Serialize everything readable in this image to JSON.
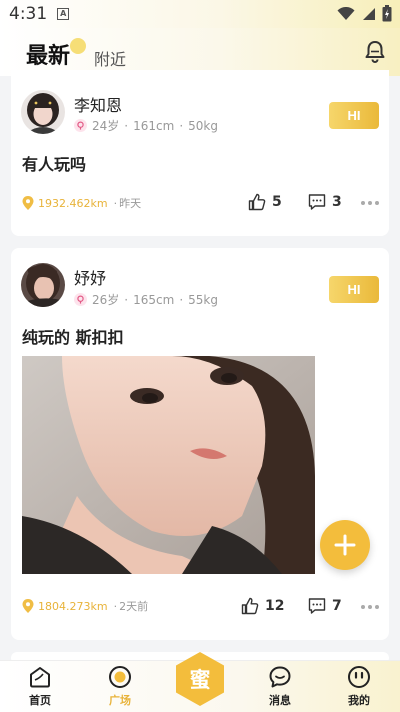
{
  "status": {
    "time": "4:31",
    "notif_glyph": "A"
  },
  "header": {
    "tab_active": "最新",
    "tab_inactive": "附近"
  },
  "posts": [
    {
      "username": "李知恩",
      "age": "24岁",
      "height": "161cm",
      "weight": "50kg",
      "hi_label": "HI",
      "text": "有人玩吗",
      "distance": "1932.462km",
      "time": "昨天",
      "likes": "5",
      "comments": "3"
    },
    {
      "username": "妤妤",
      "age": "26岁",
      "height": "165cm",
      "weight": "55kg",
      "hi_label": "HI",
      "text": "纯玩的 斯扣扣",
      "distance": "1804.273km",
      "time": "2天前",
      "likes": "12",
      "comments": "7"
    }
  ],
  "meta_sep": "·",
  "nav": {
    "home": "首页",
    "square": "广场",
    "center": "蜜",
    "messages": "消息",
    "mine": "我的"
  },
  "colors": {
    "accent": "#f3bd3c",
    "accent_text": "#e8b33a"
  }
}
